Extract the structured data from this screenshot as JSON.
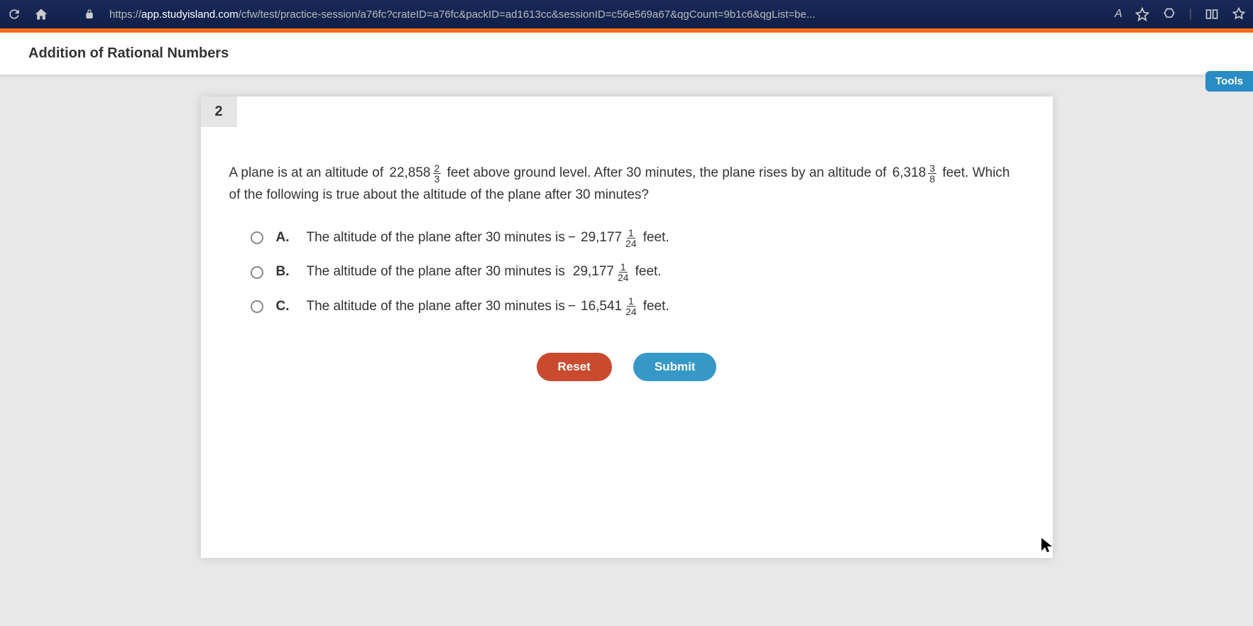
{
  "browser": {
    "url_prefix": "https://",
    "url_domain": "app.studyisland.com",
    "url_path": "/cfw/test/practice-session/a76fc?crateID=a76fc&packID=ad1613cc&sessionID=c56e569a67&qgCount=9b1c6&qgList=be...",
    "read_aloud": "A"
  },
  "header": {
    "title": "Addition of Rational Numbers",
    "tools_label": "Tools"
  },
  "question": {
    "number": "2",
    "text_1": "A plane is at an altitude of ",
    "alt1_whole": "22,858",
    "alt1_num": "2",
    "alt1_den": "3",
    "text_2": " feet above ground level. After 30 minutes, the plane rises by an altitude of ",
    "alt2_whole": "6,318",
    "alt2_num": "3",
    "alt2_den": "8",
    "text_3": " feet. Which of the following is true about the altitude of the plane after 30 minutes?"
  },
  "options": {
    "a": {
      "letter": "A.",
      "pre": "The altitude of the plane after 30 minutes is ",
      "sign": "−",
      "whole": "29,177",
      "num": "1",
      "den": "24",
      "post": " feet."
    },
    "b": {
      "letter": "B.",
      "pre": "The altitude of the plane after 30 minutes is ",
      "sign": "",
      "whole": "29,177",
      "num": "1",
      "den": "24",
      "post": " feet."
    },
    "c": {
      "letter": "C.",
      "pre": "The altitude of the plane after 30 minutes is ",
      "sign": "−",
      "whole": "16,541",
      "num": "1",
      "den": "24",
      "post": " feet."
    }
  },
  "buttons": {
    "reset": "Reset",
    "submit": "Submit"
  }
}
